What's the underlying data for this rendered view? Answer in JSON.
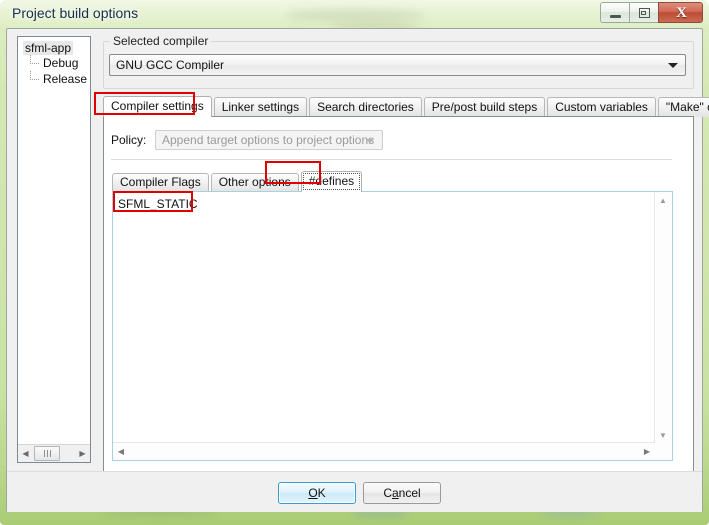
{
  "window": {
    "title": "Project build options",
    "caption_buttons": [
      {
        "name": "minimize",
        "glyph": "minimize-icon"
      },
      {
        "name": "maximize",
        "glyph": "maximize-icon"
      },
      {
        "name": "close",
        "glyph": "X"
      }
    ],
    "frame_color": "#cfe5ab",
    "accent_color": "#2f9fd4",
    "annotation_color": "#e00000"
  },
  "tree": {
    "root": "sfml-app",
    "children": [
      "Debug",
      "Release"
    ]
  },
  "compiler_group": {
    "legend": "Selected compiler",
    "selected": "GNU GCC Compiler"
  },
  "outer_tabs": [
    {
      "label": "Compiler settings",
      "active": true
    },
    {
      "label": "Linker settings",
      "active": false
    },
    {
      "label": "Search directories",
      "active": false
    },
    {
      "label": "Pre/post build steps",
      "active": false
    },
    {
      "label": "Custom variables",
      "active": false
    },
    {
      "label": "\"Make\" commands",
      "active": false
    }
  ],
  "policy": {
    "label": "Policy:",
    "value": "Append target options to project options",
    "enabled": false
  },
  "inner_tabs": [
    {
      "label": "Compiler Flags",
      "active": false
    },
    {
      "label": "Other options",
      "active": false
    },
    {
      "label": "#defines",
      "active": true
    }
  ],
  "defines_editor": {
    "lines": [
      "SFML_STATIC"
    ]
  },
  "scrollbars": {
    "up_arrow": "▲",
    "down_arrow": "▼",
    "left_arrow": "◀",
    "right_arrow": "▶"
  },
  "footer": {
    "ok": {
      "pre": "",
      "accel": "O",
      "post": "K",
      "full": "OK"
    },
    "cancel": {
      "pre": "C",
      "accel": "a",
      "post": "ncel",
      "full": "Cancel"
    }
  }
}
